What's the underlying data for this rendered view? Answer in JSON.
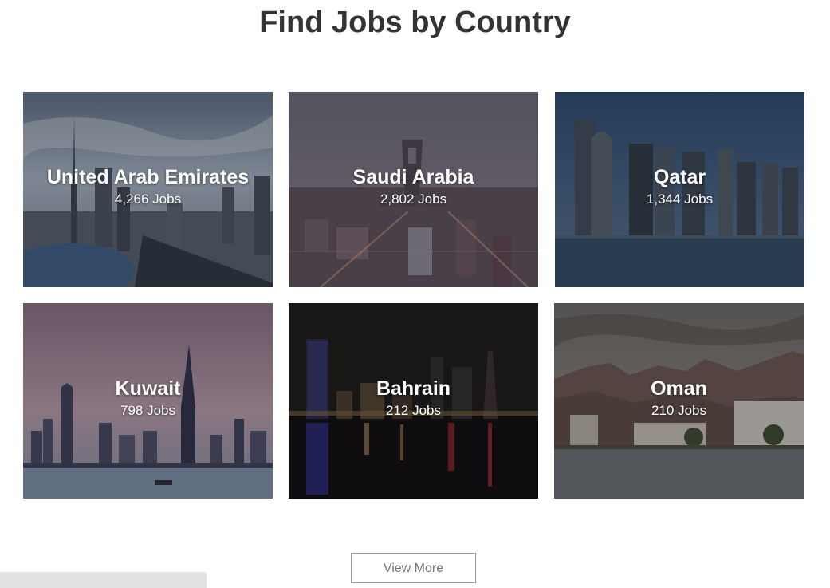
{
  "header": {
    "title": "Find Jobs by Country"
  },
  "countries": [
    {
      "name": "United Arab Emirates",
      "jobs": "4,266 Jobs",
      "image": "dubai-skyline"
    },
    {
      "name": "Saudi Arabia",
      "jobs": "2,802 Jobs",
      "image": "riyadh-skyline"
    },
    {
      "name": "Qatar",
      "jobs": "1,344 Jobs",
      "image": "doha-skyline"
    },
    {
      "name": "Kuwait",
      "jobs": "798 Jobs",
      "image": "kuwait-city-skyline"
    },
    {
      "name": "Bahrain",
      "jobs": "212 Jobs",
      "image": "manama-night-skyline"
    },
    {
      "name": "Oman",
      "jobs": "210 Jobs",
      "image": "muscat-mountains"
    }
  ],
  "footer": {
    "view_more_label": "View More"
  },
  "colors": {
    "title": "#333333",
    "card_text": "#ffffff",
    "button_border": "#9a9a9a",
    "button_text": "#777777"
  }
}
